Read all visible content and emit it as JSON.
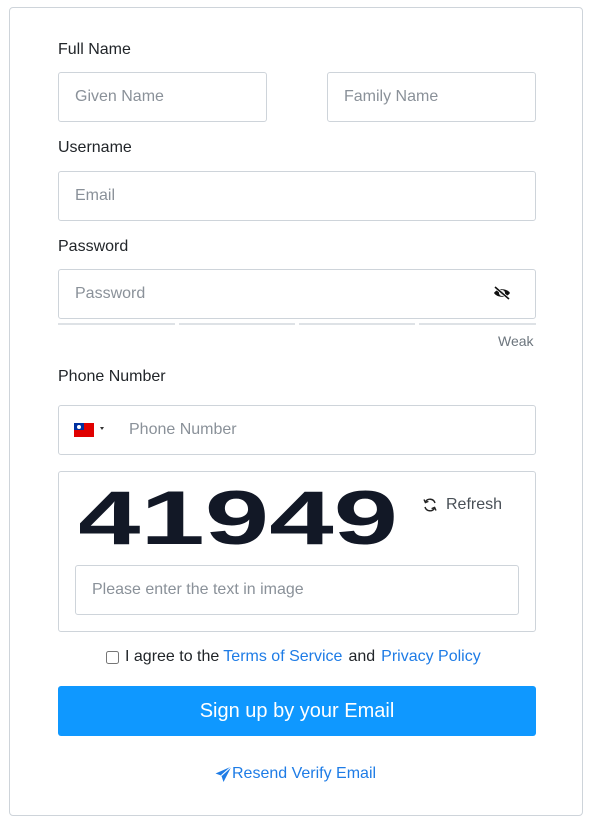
{
  "form": {
    "full_name_label": "Full Name",
    "given_name_placeholder": "Given Name",
    "family_name_placeholder": "Family Name",
    "username_label": "Username",
    "email_placeholder": "Email",
    "password_label": "Password",
    "password_placeholder": "Password",
    "password_strength": "Weak",
    "phone_label": "Phone Number",
    "phone_placeholder": "Phone Number",
    "phone_country_flag": "taiwan-flag-icon",
    "captcha_text": "41949",
    "captcha_refresh_label": "Refresh",
    "captcha_placeholder": "Please enter the text in image",
    "agree_prefix": "I agree to the",
    "terms_link": "Terms of Service",
    "agree_and": "and",
    "privacy_link": "Privacy Policy",
    "signup_button": "Sign up by your Email",
    "resend_link": "Resend Verify Email"
  },
  "colors": {
    "primary_button": "#0f98ff",
    "link": "#1e7ce6",
    "border": "#ced4da",
    "captcha_text": "#121826"
  }
}
